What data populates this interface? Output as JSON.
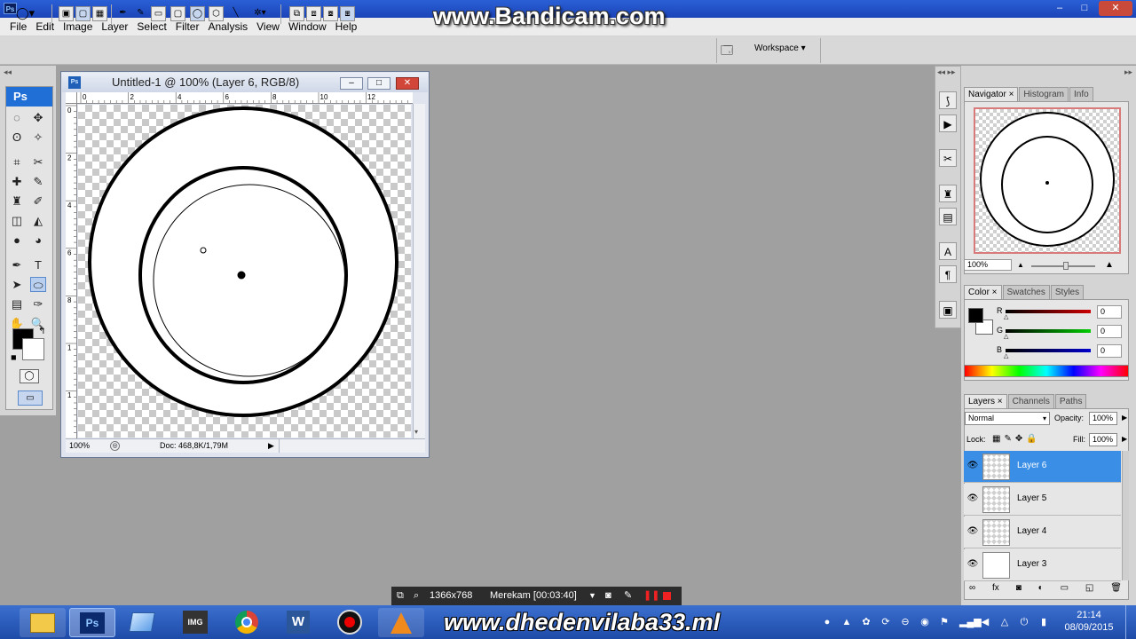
{
  "app": {
    "watermark_top": "www.Bandicam.com",
    "window_controls": {
      "minimize": "–",
      "maximize": "□",
      "close": "✕"
    },
    "ps_badge": "Ps"
  },
  "menubar": {
    "items": [
      "File",
      "Edit",
      "Image",
      "Layer",
      "Select",
      "Filter",
      "Analysis",
      "View",
      "Window",
      "Help"
    ]
  },
  "options_bar": {
    "workspace_label": "Workspace ▾"
  },
  "toolbox": {
    "header": "Ps",
    "icons": [
      "marquee-ellipse-icon",
      "move-icon",
      "lasso-icon",
      "magic-wand-icon",
      "crop-icon",
      "slice-icon",
      "healing-brush-icon",
      "brush-icon",
      "clone-stamp-icon",
      "history-brush-icon",
      "eraser-icon",
      "paint-bucket-icon",
      "blur-icon",
      "dodge-icon",
      "pen-icon",
      "type-icon",
      "path-select-icon",
      "ellipse-shape-icon",
      "notes-icon",
      "eyedropper-icon",
      "hand-icon",
      "zoom-icon"
    ],
    "glyphs": [
      "◌",
      "✥",
      "ʘ",
      "✧",
      "⌗",
      "✂",
      "✚",
      "✎",
      "♜",
      "✐",
      "◫",
      "◭",
      "●",
      "◕",
      "✒",
      "T",
      "➤",
      "⬭",
      "▤",
      "✑",
      "✋",
      "🔍"
    ],
    "selected_index": 17,
    "foreground_color": "#000000",
    "background_color": "#ffffff"
  },
  "document": {
    "title": "Untitled-1 @ 100% (Layer 6, RGB/8)",
    "zoom": "100%",
    "doc_size": "Doc: 468,8K/1,79M",
    "ruler_top_labels": [
      "0",
      "2",
      "4",
      "6",
      "8",
      "10",
      "12"
    ],
    "ruler_left_labels": [
      "0",
      "2",
      "4",
      "6",
      "8",
      "1",
      "1"
    ]
  },
  "navigator": {
    "tabs": [
      "Navigator ×",
      "Histogram",
      "Info"
    ],
    "zoom": "100%"
  },
  "color_panel": {
    "tabs": [
      "Color ×",
      "Swatches",
      "Styles"
    ],
    "channels": [
      {
        "label": "R",
        "value": "0",
        "color": "#d02020"
      },
      {
        "label": "G",
        "value": "0",
        "color": "#20a020"
      },
      {
        "label": "B",
        "value": "0",
        "color": "#2030c8"
      }
    ]
  },
  "layers_panel": {
    "tabs": [
      "Layers ×",
      "Channels",
      "Paths"
    ],
    "blend_mode": "Normal",
    "opacity_label": "Opacity:",
    "opacity_value": "100%",
    "lock_label": "Lock:",
    "fill_label": "Fill:",
    "fill_value": "100%",
    "layers": [
      {
        "name": "Layer 6",
        "selected": true
      },
      {
        "name": "Layer 5",
        "selected": false
      },
      {
        "name": "Layer 4",
        "selected": false
      },
      {
        "name": "Layer 3",
        "selected": false
      }
    ],
    "footer_icons": [
      "∞",
      "fx",
      "◙",
      "◐",
      "▭",
      "◱",
      "🗑"
    ]
  },
  "recorder": {
    "resolution": "1366x768",
    "status": "Merekam [00:03:40]"
  },
  "taskbar": {
    "watermark_bottom": "www.dhedenvilaba33.ml",
    "clock_time": "21:14",
    "clock_date": "08/09/2015",
    "ps_label": "Ps",
    "word_label": "W"
  }
}
